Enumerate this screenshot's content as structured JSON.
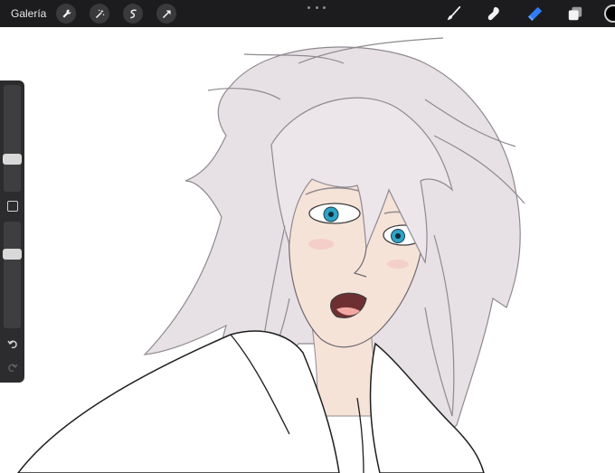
{
  "topbar": {
    "gallery_label": "Galería",
    "left_tools": [
      "wrench-icon",
      "magic-wand-icon",
      "selection-icon",
      "transform-arrow-icon"
    ],
    "right_tools": [
      "brush-icon",
      "smudge-icon",
      "eraser-icon",
      "layers-icon"
    ],
    "active_tool": "eraser-icon",
    "active_color": "#2f7cf6",
    "current_color": "#000000"
  },
  "sidebar": {
    "brush_size_level": 0.28,
    "opacity_level": 0.28
  },
  "canvas": {
    "subject": "anime-character-drawing",
    "hair_color": "#e7e1e6",
    "skin_color": "#f6e3d8",
    "eye_color": "#2fa3c6",
    "robe_color": "#ffffff"
  }
}
